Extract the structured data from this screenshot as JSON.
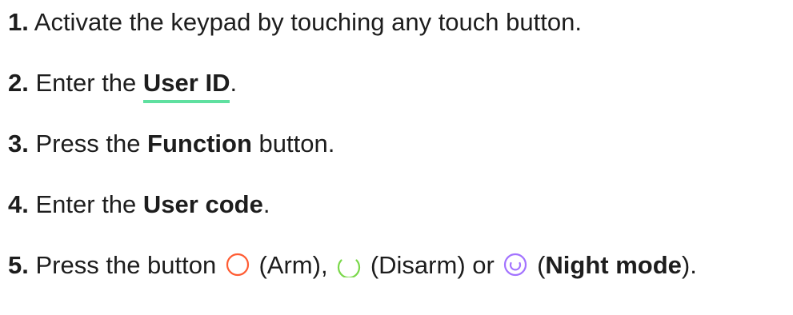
{
  "steps": [
    {
      "number": "1.",
      "text": "Activate the keypad by touching any touch button."
    },
    {
      "number": "2.",
      "before": "Enter the ",
      "link": "User ID",
      "after": "."
    },
    {
      "number": "3.",
      "before": "Press the ",
      "bold": "Function",
      "after": " button."
    },
    {
      "number": "4.",
      "before": "Enter the ",
      "bold": "User code",
      "after": "."
    },
    {
      "number": "5.",
      "before": "Press the button ",
      "arm": "(Arm),",
      "disarm": "(Disarm) or",
      "night_open": "(",
      "night_bold": "Night mode",
      "night_close": ")."
    }
  ],
  "icons": {
    "arm": {
      "name": "arm-circle-icon",
      "color": "#ff5c33"
    },
    "disarm": {
      "name": "disarm-arc-icon",
      "color": "#7ad84a"
    },
    "night": {
      "name": "night-mode-icon",
      "color": "#a373ff"
    }
  },
  "colors": {
    "text": "#1d1d1d",
    "link_underline": "#5fe0a0"
  }
}
